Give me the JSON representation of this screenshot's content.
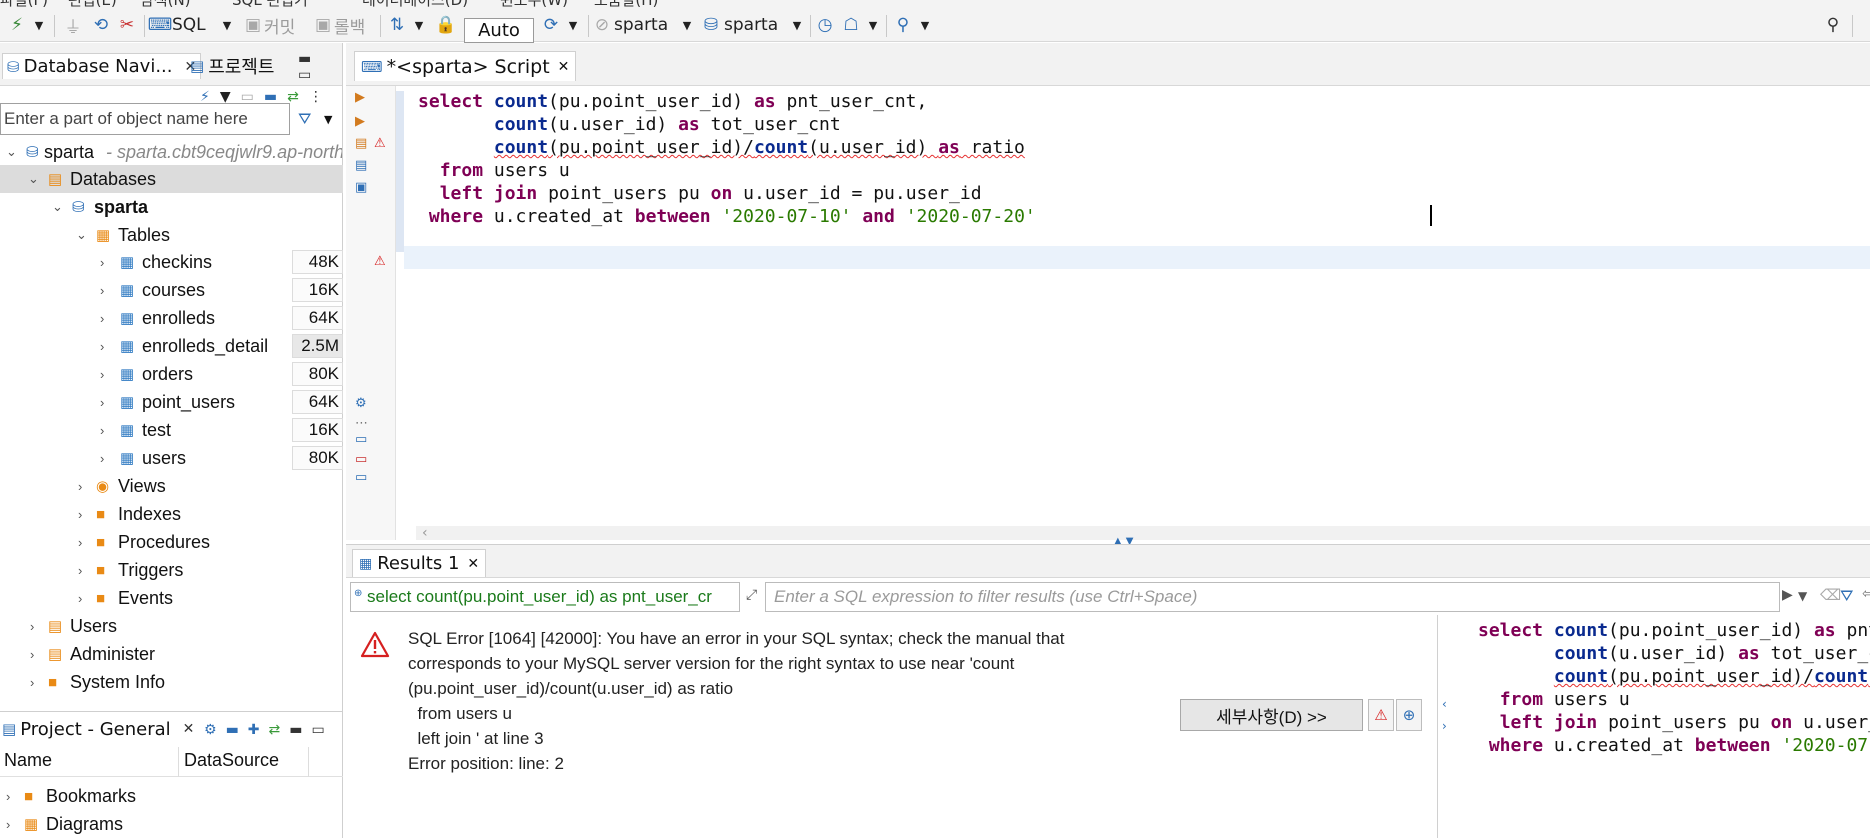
{
  "menubar": {
    "items": [
      "파일(F)",
      "편집(E)",
      "탐색(N)",
      "SQL 편집기",
      "데이터베이스(D)",
      "윈도우(W)",
      "도움말(H)"
    ]
  },
  "toolbar": {
    "sql_label": "SQL",
    "commit_label": "커밋",
    "rollback_label": "롤백",
    "transaction_mode": "Auto",
    "datasource": "sparta",
    "schema": "sparta"
  },
  "navigator": {
    "tab_label": "Database Navi...",
    "project_tab_label": "프로젝트",
    "filter_placeholder": "Enter a part of object name here",
    "connection": {
      "name": "sparta",
      "host": "- sparta.cbt9ceqjwlr9.ap-north"
    },
    "databases_label": "Databases",
    "schema_label": "sparta",
    "tables_label": "Tables",
    "tables": [
      {
        "name": "checkins",
        "size": "48K"
      },
      {
        "name": "courses",
        "size": "16K"
      },
      {
        "name": "enrolleds",
        "size": "64K"
      },
      {
        "name": "enrolleds_detail",
        "size": "2.5M"
      },
      {
        "name": "orders",
        "size": "80K"
      },
      {
        "name": "point_users",
        "size": "64K"
      },
      {
        "name": "test",
        "size": "16K"
      },
      {
        "name": "users",
        "size": "80K"
      }
    ],
    "schema_folders": [
      "Views",
      "Indexes",
      "Procedures",
      "Triggers",
      "Events"
    ],
    "root_folders": [
      "Users",
      "Administer",
      "System Info"
    ]
  },
  "project": {
    "tab_label": "Project - General",
    "columns": [
      "Name",
      "DataSource"
    ],
    "items": [
      "Bookmarks",
      "Diagrams"
    ]
  },
  "editor": {
    "tab_label": "*<sparta> Script",
    "lines": [
      [
        {
          "t": "select ",
          "c": "kw"
        },
        {
          "t": "count",
          "c": "fn"
        },
        {
          "t": "(pu.point_user_id) "
        },
        {
          "t": "as",
          "c": "kw"
        },
        {
          "t": " pnt_user_cnt,"
        }
      ],
      [
        {
          "t": "       "
        },
        {
          "t": "count",
          "c": "fn"
        },
        {
          "t": "(u.user_id) "
        },
        {
          "t": "as",
          "c": "kw"
        },
        {
          "t": " tot_user_cnt"
        }
      ],
      [
        {
          "t": "       "
        },
        {
          "t": "count",
          "c": "fn",
          "s": true
        },
        {
          "t": "(pu.point_user_id)/",
          "s": true
        },
        {
          "t": "count",
          "c": "fn",
          "s": true
        },
        {
          "t": "(u.user_id) ",
          "s": true
        },
        {
          "t": "as",
          "c": "kw",
          "s": true
        },
        {
          "t": " ratio",
          "s": true
        }
      ],
      [
        {
          "t": "  "
        },
        {
          "t": "from",
          "c": "kw"
        },
        {
          "t": " users u"
        }
      ],
      [
        {
          "t": "  "
        },
        {
          "t": "left join",
          "c": "kw"
        },
        {
          "t": " point_users pu "
        },
        {
          "t": "on",
          "c": "kw"
        },
        {
          "t": " u.user_id = pu.user_id"
        }
      ],
      [
        {
          "t": " "
        },
        {
          "t": "where",
          "c": "kw"
        },
        {
          "t": " u.created_at "
        },
        {
          "t": "between",
          "c": "kw"
        },
        {
          "t": " "
        },
        {
          "t": "'2020-07-10'",
          "c": "str"
        },
        {
          "t": " "
        },
        {
          "t": "and",
          "c": "kw"
        },
        {
          "t": " "
        },
        {
          "t": "'2020-07-20'",
          "c": "str"
        }
      ]
    ]
  },
  "results": {
    "tab_label": "Results 1",
    "query_preview": "select count(pu.point_user_id) as pnt_user_cr",
    "filter_placeholder": "Enter a SQL expression to filter results (use Ctrl+Space)",
    "error_lines": [
      "SQL Error [1064] [42000]: You have an error in your SQL syntax; check the manual that",
      "corresponds to your MySQL server version for the right syntax to use near 'count",
      "(pu.point_user_id)/count(u.user_id) as ratio",
      "  from users u",
      "  left join ' at line 3",
      "Error position: line: 2"
    ],
    "details_button": "세부사항(D) >>"
  }
}
